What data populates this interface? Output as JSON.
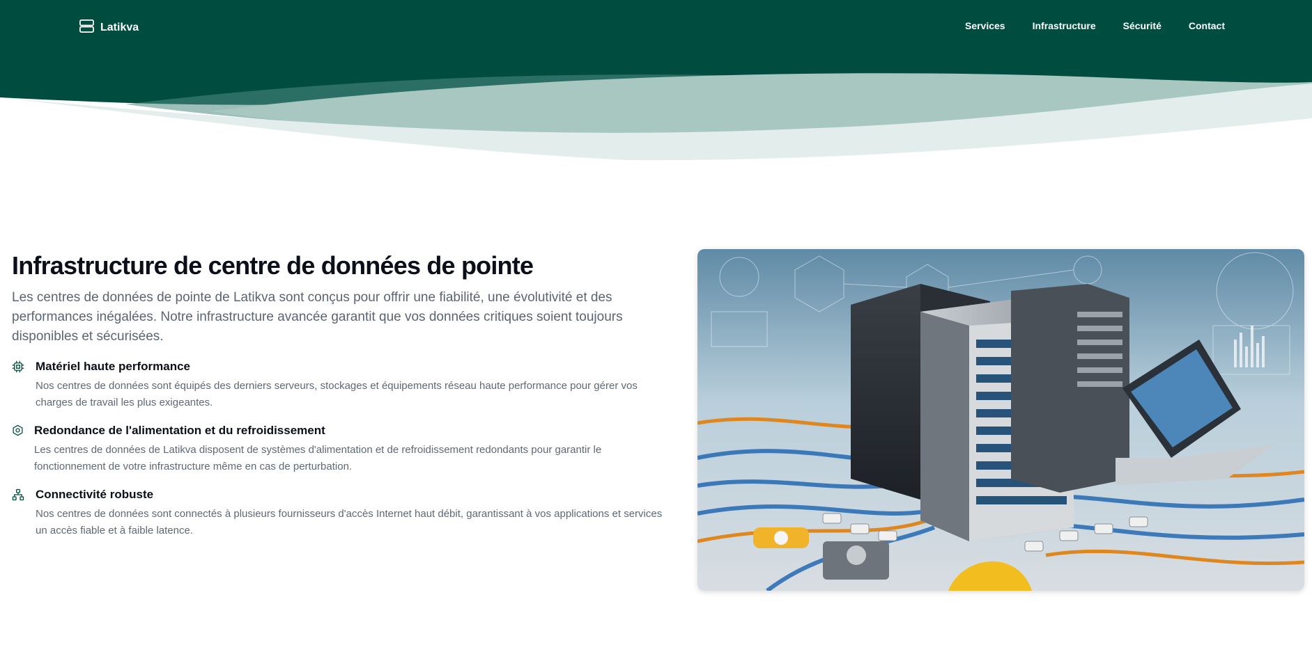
{
  "brand": {
    "name": "Latikva",
    "icon": "server-stack-icon"
  },
  "nav": {
    "items": [
      "Services",
      "Infrastructure",
      "Sécurité",
      "Contact"
    ]
  },
  "colors": {
    "header": "#004d40",
    "wave_mid": "#4f8a80",
    "wave_light": "#a7c7c0",
    "wave_lightest": "#e3edeb"
  },
  "hero": {
    "title": "Infrastructure de centre de données de pointe",
    "intro": "Les centres de données de pointe de Latikva sont conçus pour offrir une fiabilité, une évolutivité et des performances inégalées. Notre infrastructure avancée garantit que vos données critiques soient toujours disponibles et sécurisées."
  },
  "features": [
    {
      "icon": "cpu-chip-icon",
      "title": "Matériel haute performance",
      "text": "Nos centres de données sont équipés des derniers serveurs, stockages et équipements réseau haute performance pour gérer vos charges de travail les plus exigeantes."
    },
    {
      "icon": "hexagon-icon",
      "title": "Redondance de l'alimentation et du refroidissement",
      "text": "Les centres de données de Latikva disposent de systèmes d'alimentation et de refroidissement redondants pour garantir le fonctionnement de votre infrastructure même en cas de perturbation."
    },
    {
      "icon": "network-icon",
      "title": "Connectivité robuste",
      "text": "Nos centres de données sont connectés à plusieurs fournisseurs d'accès Internet haut débit, garantissant à vos applications et services un accès fiable et à faible latence."
    }
  ]
}
